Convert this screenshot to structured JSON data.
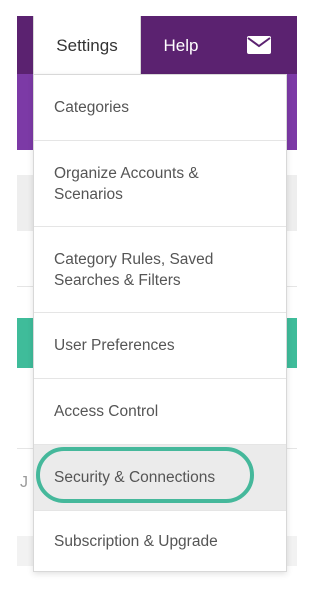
{
  "nav": {
    "settings_label": "Settings",
    "help_label": "Help",
    "mail_icon": "envelope-icon"
  },
  "menu": {
    "items": [
      {
        "label": "Categories"
      },
      {
        "label": "Organize Accounts & Scenarios"
      },
      {
        "label": "Category Rules, Saved Searches & Filters"
      },
      {
        "label": "User Preferences"
      },
      {
        "label": "Access Control"
      },
      {
        "label": "Security & Connections",
        "highlighted": true
      },
      {
        "label": "Subscription & Upgrade"
      }
    ]
  },
  "background": {
    "fragment_text": "J"
  },
  "colors": {
    "topbar": "#5b2270",
    "purple_band": "#7c3aa6",
    "teal": "#3fbc9a",
    "highlight_ring": "#45b89b"
  }
}
